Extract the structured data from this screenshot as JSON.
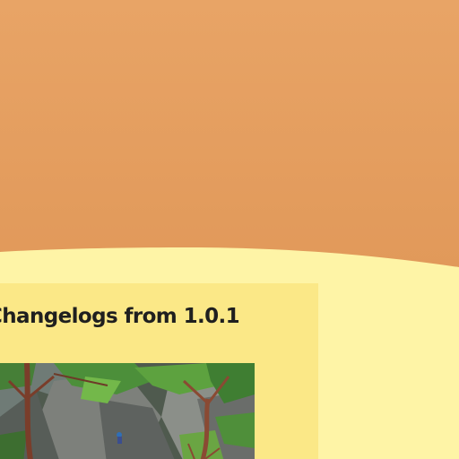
{
  "theme": {
    "sky_top": "#e8a466",
    "sky_bottom": "#e29c5c",
    "page_background": "#fef4a6",
    "card_background": "#fbe887",
    "title_color": "#1f1f1f"
  },
  "changelog": {
    "title": "Changelogs from 1.0.1",
    "image_icon": "game-screenshot-forest-cliff"
  }
}
